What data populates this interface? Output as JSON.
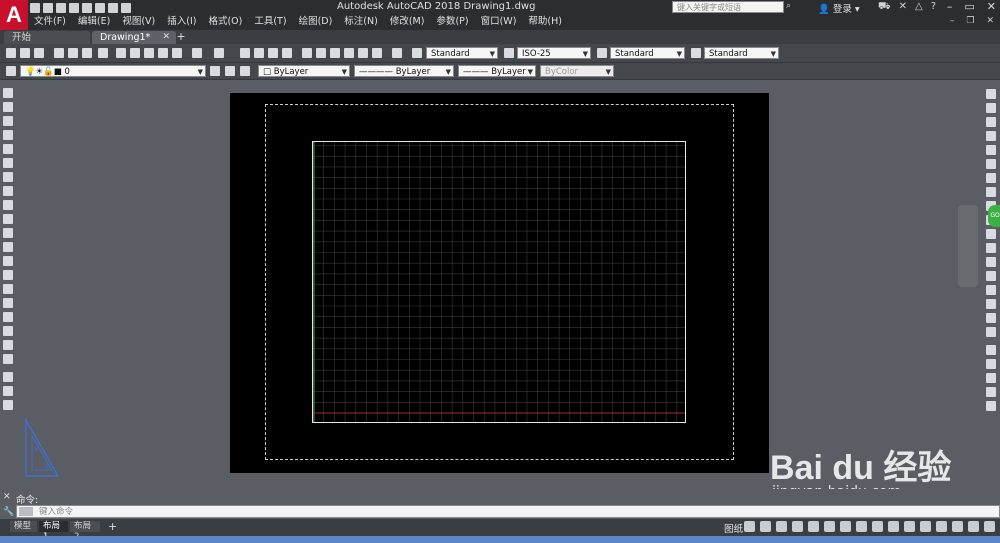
{
  "title_bar": {
    "app_title": "Autodesk AutoCAD 2018    Drawing1.dwg",
    "search_placeholder": "键入关键字或短语",
    "login_label": "登录"
  },
  "menu": [
    "文件(F)",
    "编辑(E)",
    "视图(V)",
    "插入(I)",
    "格式(O)",
    "工具(T)",
    "绘图(D)",
    "标注(N)",
    "修改(M)",
    "参数(P)",
    "窗口(W)",
    "帮助(H)"
  ],
  "doc_tabs": {
    "start": "开始",
    "drawing": "Drawing1*"
  },
  "toolbar": {
    "text_style": "Standard",
    "dim_style": "ISO-25",
    "table_style": "Standard",
    "multileader_style": "Standard",
    "layer": "0",
    "color": "ByLayer",
    "linetype": "ByLayer",
    "lineweight": "ByLayer",
    "plot_style": "ByColor"
  },
  "command": {
    "label": "命令:",
    "placeholder": "键入命令"
  },
  "layout_tabs": {
    "model": "模型",
    "layout1": "布局1",
    "layout2": "布局2"
  },
  "status": {
    "paper_mode": "图纸"
  },
  "watermark": {
    "logo": "Bai du 经验",
    "url": "jingyan.baidu.com"
  },
  "colors": {
    "title_bg": "#2b2d31",
    "canvas_bg": "#5a5d63",
    "paper": "#000000",
    "logo_red": "#c8102e"
  }
}
